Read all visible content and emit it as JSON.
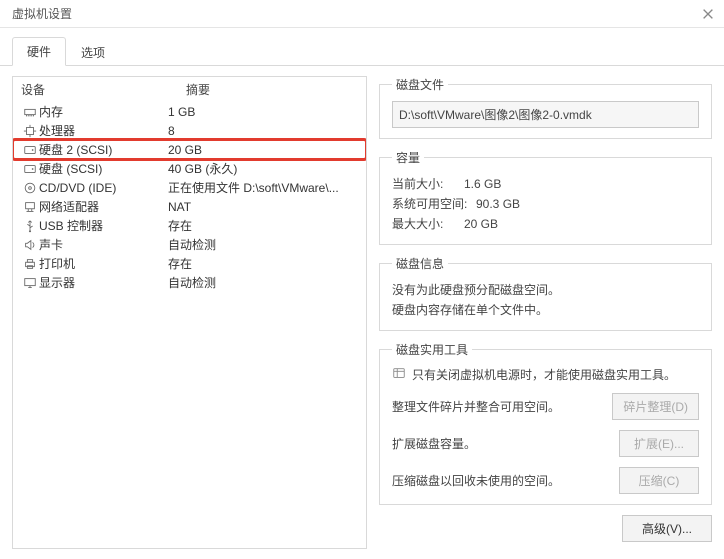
{
  "window": {
    "title": "虚拟机设置"
  },
  "tabs": {
    "hardware": "硬件",
    "options": "选项",
    "active": "hardware"
  },
  "list_headers": {
    "device": "设备",
    "summary": "摘要"
  },
  "devices": [
    {
      "name": "内存",
      "summary": "1 GB",
      "icon": "memory-icon"
    },
    {
      "name": "处理器",
      "summary": "8",
      "icon": "cpu-icon"
    },
    {
      "name": "硬盘 2 (SCSI)",
      "summary": "20 GB",
      "icon": "disk-icon",
      "highlight": true
    },
    {
      "name": "硬盘 (SCSI)",
      "summary": "40 GB (永久)",
      "icon": "disk-icon"
    },
    {
      "name": "CD/DVD (IDE)",
      "summary": "正在使用文件 D:\\soft\\VMware\\...",
      "icon": "cd-icon"
    },
    {
      "name": "网络适配器",
      "summary": "NAT",
      "icon": "network-icon"
    },
    {
      "name": "USB 控制器",
      "summary": "存在",
      "icon": "usb-icon"
    },
    {
      "name": "声卡",
      "summary": "自动检测",
      "icon": "sound-icon"
    },
    {
      "name": "打印机",
      "summary": "存在",
      "icon": "printer-icon"
    },
    {
      "name": "显示器",
      "summary": "自动检测",
      "icon": "display-icon"
    }
  ],
  "disk_file": {
    "legend": "磁盘文件",
    "path": "D:\\soft\\VMware\\图像2\\图像2-0.vmdk"
  },
  "capacity": {
    "legend": "容量",
    "current_label": "当前大小:",
    "current_value": "1.6 GB",
    "free_label": "系统可用空间:",
    "free_value": "90.3 GB",
    "max_label": "最大大小:",
    "max_value": "20 GB"
  },
  "disk_info": {
    "legend": "磁盘信息",
    "line1": "没有为此硬盘预分配磁盘空间。",
    "line2": "硬盘内容存储在单个文件中。"
  },
  "tools": {
    "legend": "磁盘实用工具",
    "note": "只有关闭虚拟机电源时，才能使用磁盘实用工具。",
    "defrag_desc": "整理文件碎片并整合可用空间。",
    "defrag_btn": "碎片整理(D)",
    "expand_desc": "扩展磁盘容量。",
    "expand_btn": "扩展(E)...",
    "compact_desc": "压缩磁盘以回收未使用的空间。",
    "compact_btn": "压缩(C)"
  },
  "buttons": {
    "advanced": "高级(V)..."
  }
}
